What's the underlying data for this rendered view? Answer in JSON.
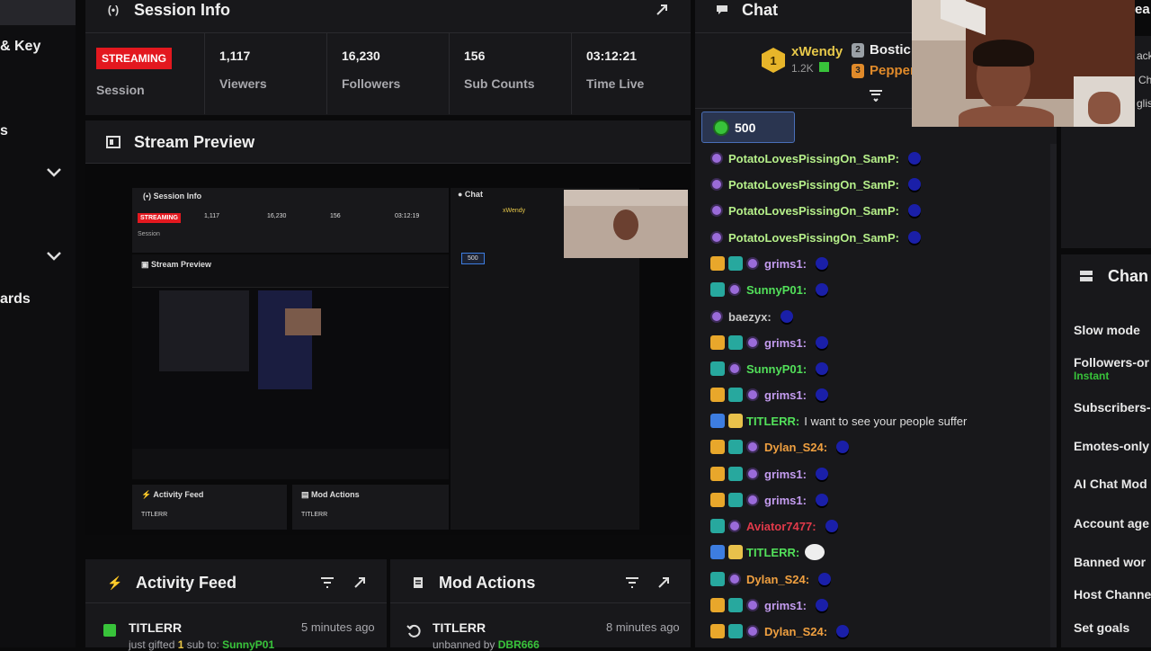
{
  "sidebar": {
    "items": [
      {
        "label": "& Key"
      },
      {
        "label": "s"
      },
      {
        "label": "ards"
      }
    ]
  },
  "session": {
    "title": "Session Info",
    "status": "STREAMING",
    "status_sub": "Session",
    "stats": [
      {
        "value": "1,117",
        "label": "Viewers"
      },
      {
        "value": "16,230",
        "label": "Followers"
      },
      {
        "value": "156",
        "label": "Sub Counts"
      },
      {
        "value": "03:12:21",
        "label": "Time Live"
      }
    ]
  },
  "preview": {
    "title": "Stream Preview"
  },
  "activity": {
    "title": "Activity Feed",
    "user": "TITLERR",
    "time": "5 minutes ago",
    "text": "just gifted",
    "count": "1",
    "text2": "sub to:",
    "target": "SunnyP01"
  },
  "mod": {
    "title": "Mod Actions",
    "user": "TITLERR",
    "time": "8 minutes ago",
    "text": "unbanned by",
    "by": "DBR666"
  },
  "chat": {
    "title": "Chat",
    "leaders": [
      {
        "rank": "1",
        "name": "xWendy",
        "amount": "1.2K"
      },
      {
        "rank": "2",
        "name": "Bostic"
      },
      {
        "rank": "3",
        "name": "Pepper"
      }
    ],
    "points": "500",
    "messages": [
      {
        "badges": [],
        "user": "PotatoLovesPissingOn_SamP:",
        "color": "#b6f08a",
        "text": "",
        "blob": true
      },
      {
        "badges": [],
        "user": "PotatoLovesPissingOn_SamP:",
        "color": "#b6f08a",
        "text": "",
        "blob": true
      },
      {
        "badges": [],
        "user": "PotatoLovesPissingOn_SamP:",
        "color": "#b6f08a",
        "text": "",
        "blob": true
      },
      {
        "badges": [],
        "user": "PotatoLovesPissingOn_SamP:",
        "color": "#b6f08a",
        "text": "",
        "blob": true
      },
      {
        "badges": [
          "crown",
          "gift"
        ],
        "user": "grims1:",
        "color": "#c49cf0",
        "text": "",
        "blob": true
      },
      {
        "badges": [
          "gift"
        ],
        "user": "SunnyP01:",
        "color": "#52e05a",
        "text": "",
        "blob": true
      },
      {
        "badges": [],
        "user": "baezyx:",
        "color": "#c9c9c9",
        "text": "",
        "blob": true
      },
      {
        "badges": [
          "crown",
          "gift"
        ],
        "user": "grims1:",
        "color": "#c49cf0",
        "text": "",
        "blob": true
      },
      {
        "badges": [
          "gift"
        ],
        "user": "SunnyP01:",
        "color": "#52e05a",
        "text": "",
        "blob": true
      },
      {
        "badges": [
          "crown",
          "gift"
        ],
        "user": "grims1:",
        "color": "#c49cf0",
        "text": "",
        "blob": true
      },
      {
        "badges": [
          "pick",
          "box"
        ],
        "user": "TITLERR:",
        "color": "#52e05a",
        "text": "I want to see your people suffer",
        "blob": false
      },
      {
        "badges": [
          "crown",
          "gift"
        ],
        "user": "Dylan_S24:",
        "color": "#f0a040",
        "text": "",
        "blob": true
      },
      {
        "badges": [
          "crown",
          "gift"
        ],
        "user": "grims1:",
        "color": "#c49cf0",
        "text": "",
        "blob": true
      },
      {
        "badges": [
          "crown",
          "gift"
        ],
        "user": "grims1:",
        "color": "#c49cf0",
        "text": "",
        "blob": true
      },
      {
        "badges": [
          "gift"
        ],
        "user": "Aviator7477:",
        "color": "#e03a4a",
        "text": "",
        "blob": true
      },
      {
        "badges": [
          "pick",
          "box"
        ],
        "user": "TITLERR:",
        "color": "#52e05a",
        "text": "",
        "blob": false,
        "emote": true
      },
      {
        "badges": [
          "gift"
        ],
        "user": "Dylan_S24:",
        "color": "#f0a040",
        "text": "",
        "blob": true
      },
      {
        "badges": [
          "crown",
          "gift"
        ],
        "user": "grims1:",
        "color": "#c49cf0",
        "text": "",
        "blob": true
      },
      {
        "badges": [
          "crown",
          "gift"
        ],
        "user": "Dylan_S24:",
        "color": "#f0a040",
        "text": "",
        "blob": true
      }
    ]
  },
  "settings": {
    "title": "Chan",
    "items": [
      {
        "label": "Slow mode"
      },
      {
        "label": "Followers-or",
        "sub": "Instant"
      },
      {
        "label": "Subscribers-"
      },
      {
        "label": "Emotes-only"
      },
      {
        "label": "AI Chat Mod"
      },
      {
        "label": "Account age"
      },
      {
        "label": "Banned wor"
      },
      {
        "label": "Host Channe"
      },
      {
        "label": "Set goals"
      }
    ]
  },
  "edge": {
    "lines": [
      "ea",
      "ack",
      "Ch",
      "glis"
    ]
  }
}
